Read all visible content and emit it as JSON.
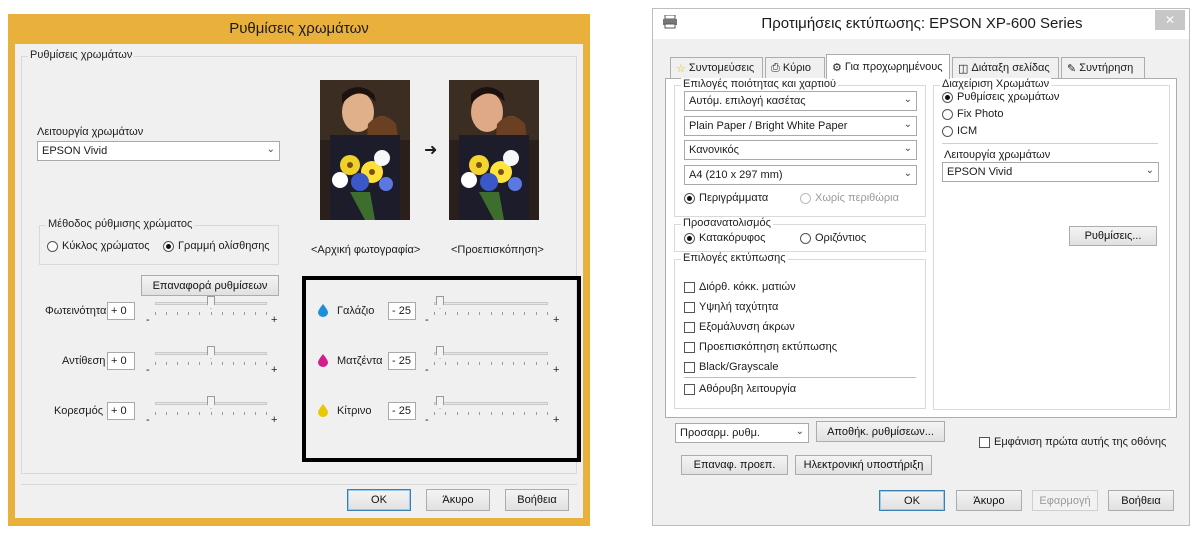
{
  "left_dialog": {
    "title": "Ρυθμίσεις χρωμάτων",
    "group_title": "Ρυθμίσεις χρωμάτων",
    "mode_label": "Λειτουργία χρωμάτων",
    "mode_value": "EPSON Vivid",
    "method_group": "Μέθοδος ρύθμισης χρώματος",
    "method_options": [
      "Κύκλος χρώματος",
      "Γραμμή ολίσθησης"
    ],
    "original_caption": "<Αρχική φωτογραφία>",
    "preview_caption": "<Προεπισκόπηση>",
    "reset_button": "Επαναφορά ρυθμίσεων",
    "adjust": [
      {
        "label": "Φωτεινότητα",
        "value": "+ 0",
        "level": 0.5
      },
      {
        "label": "Αντίθεση",
        "value": "+ 0",
        "level": 0.5
      },
      {
        "label": "Κορεσμός",
        "value": "+ 0",
        "level": 0.5
      }
    ],
    "inks": [
      {
        "label": "Γαλάζιο",
        "value": "- 25",
        "color": "#1e8fd6",
        "level": 0.02
      },
      {
        "label": "Ματζέντα",
        "value": "- 25",
        "color": "#d41d8e",
        "level": 0.02
      },
      {
        "label": "Κίτρινο",
        "value": "- 25",
        "color": "#e8c800",
        "level": 0.02
      }
    ],
    "minus": "-",
    "plus": "+",
    "ok": "OK",
    "cancel": "Άκυρο",
    "help": "Βοήθεια",
    "colors": {
      "titlebar": "#f7c65a",
      "frame": "#eab03c"
    }
  },
  "right_dialog": {
    "title": "Προτιμήσεις εκτύπωσης: EPSON XP-600 Series",
    "close": "✕",
    "tabs": [
      {
        "label": "Συντομεύσεις",
        "icon": "star-icon"
      },
      {
        "label": "Κύριο",
        "icon": "printer-icon"
      },
      {
        "label": "Για προχωρημένους",
        "icon": "gears-icon"
      },
      {
        "label": "Διάταξη σελίδας",
        "icon": "page-layout-icon"
      },
      {
        "label": "Συντήρηση",
        "icon": "wrench-icon"
      }
    ],
    "quality_group": "Επιλογές ποιότητας και χαρτιού",
    "source_select": "Αυτόμ. επιλογή κασέτας",
    "paper_select": "Plain Paper / Bright White Paper",
    "quality_select": "Κανονικός",
    "size_select": "A4 (210 x 297 mm)",
    "border_options": [
      "Περιγράμματα",
      "Χωρίς περιθώρια"
    ],
    "orientation_group": "Προσανατολισμός",
    "orientation_options": [
      "Κατακόρυφος",
      "Οριζόντιος"
    ],
    "print_group": "Επιλογές εκτύπωσης",
    "print_options": [
      "Διόρθ. κόκκ. ματιών",
      "Υψηλή ταχύτητα",
      "Εξομάλυνση άκρων",
      "Προεπισκόπηση εκτύπωσης",
      "Black/Grayscale",
      "Αθόρυβη λειτουργία"
    ],
    "color_mgmt_group": "Διαχείριση Χρωμάτων",
    "color_mgmt_options": [
      "Ρυθμίσεις χρωμάτων",
      "Fix Photo",
      "ICM"
    ],
    "color_mode_label": "Λειτουργία χρωμάτων",
    "color_mode_value": "EPSON Vivid",
    "settings_button": "Ρυθμίσεις...",
    "custom_select": "Προσαρμ. ρυθμ.",
    "save_button": "Αποθήκ. ρυθμίσεων...",
    "show_first": "Εμφάνιση πρώτα αυτής της οθόνης",
    "reset_defaults": "Επαναφ. προεπ.",
    "online_support": "Ηλεκτρονική υποστήριξη",
    "ok": "OK",
    "cancel": "Άκυρο",
    "apply": "Εφαρμογή",
    "help": "Βοήθεια"
  }
}
